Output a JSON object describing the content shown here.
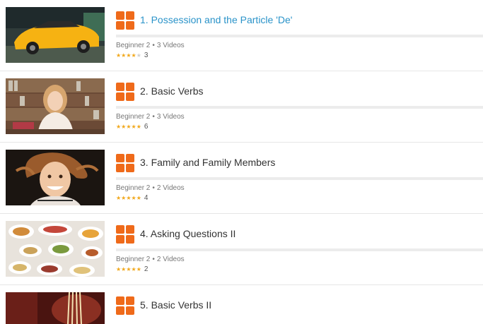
{
  "colors": {
    "accent_orange": "#ef6a1a",
    "active_title": "#2a93c9",
    "star_on": "#f1a81c",
    "star_off": "#cfcfcf"
  },
  "lessons": [
    {
      "title": "1. Possession and the Particle 'De'",
      "level": "Beginner 2",
      "videos": "3 Videos",
      "stars": 4,
      "rating_count": "3",
      "active": true,
      "thumb": "yellow-sports-car"
    },
    {
      "title": "2. Basic Verbs",
      "level": "Beginner 2",
      "videos": "3 Videos",
      "stars": 5,
      "rating_count": "6",
      "active": false,
      "thumb": "girl-at-bookshelf"
    },
    {
      "title": "3. Family and Family Members",
      "level": "Beginner 2",
      "videos": "2 Videos",
      "stars": 5,
      "rating_count": "4",
      "active": false,
      "thumb": "smiling-child"
    },
    {
      "title": "4. Asking Questions II",
      "level": "Beginner 2",
      "videos": "2 Videos",
      "stars": 5,
      "rating_count": "2",
      "active": false,
      "thumb": "dishes-on-table"
    },
    {
      "title": "5. Basic Verbs II",
      "active": false,
      "thumb": "noodles"
    }
  ]
}
